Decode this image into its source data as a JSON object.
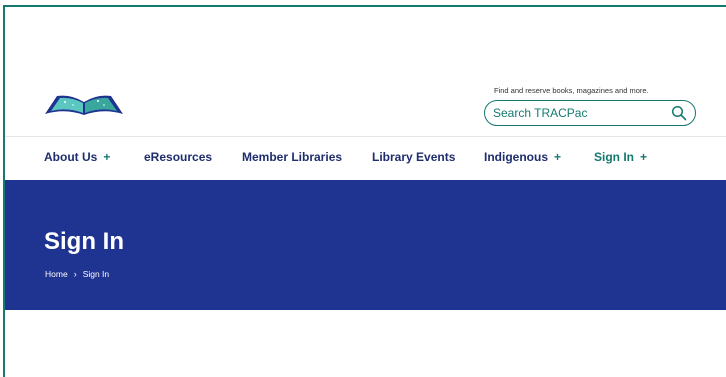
{
  "header": {
    "tagline": "Find and reserve books, magazines and more.",
    "search_placeholder": "Search TRACPac"
  },
  "nav": {
    "items": [
      {
        "label": "About Us",
        "has_plus": true
      },
      {
        "label": "eResources",
        "has_plus": false
      },
      {
        "label": "Member Libraries",
        "has_plus": false
      },
      {
        "label": "Library Events",
        "has_plus": false
      },
      {
        "label": "Indigenous",
        "has_plus": true
      },
      {
        "label": "Sign In",
        "has_plus": true
      }
    ],
    "plus_symbol": "+"
  },
  "hero": {
    "title": "Sign In",
    "breadcrumb": {
      "home": "Home",
      "separator": "›",
      "current": "Sign In"
    }
  },
  "colors": {
    "brand_navy": "#1f3391",
    "accent_teal": "#14796f",
    "nav_text": "#1f2d6e"
  }
}
